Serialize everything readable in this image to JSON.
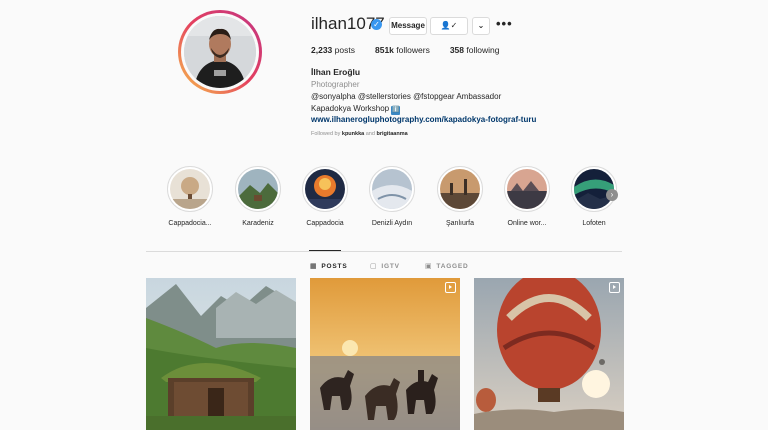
{
  "profile": {
    "username": "ilhan1077",
    "message_label": "Message",
    "stats": {
      "posts_count": "2,233",
      "posts_label": "posts",
      "followers_count": "851k",
      "followers_label": "followers",
      "following_count": "358",
      "following_label": "following"
    },
    "full_name": "İlhan Eroğlu",
    "category": "Photographer",
    "bio_line1": "@sonyalpha @stellerstories @fstopgear Ambassador",
    "bio_line2": "Kapadokya Workshop",
    "bio_line2_emoji": "ℹ️",
    "website": "www.ilhanerogluphotography.com/kapadokya-fotograf-turu",
    "followed_by_prefix": "Followed by",
    "followed_by_user1": "kpunkka",
    "followed_by_and": "and",
    "followed_by_user2": "brigitaanma"
  },
  "highlights": [
    {
      "label": "Cappadocia..."
    },
    {
      "label": "Karadeniz"
    },
    {
      "label": "Cappadocia"
    },
    {
      "label": "Denizli Aydın"
    },
    {
      "label": "Şanlıurfa"
    },
    {
      "label": "Online wor..."
    },
    {
      "label": "Lofoten"
    }
  ],
  "tabs": [
    {
      "label": "POSTS",
      "icon": "grid-icon"
    },
    {
      "label": "IGTV",
      "icon": "igtv-icon"
    },
    {
      "label": "TAGGED",
      "icon": "tag-icon"
    }
  ],
  "colors": {
    "accent": "#3897f0",
    "link": "#00376b",
    "secondary_text": "#8e8e8e",
    "border": "#dbdbdb"
  }
}
